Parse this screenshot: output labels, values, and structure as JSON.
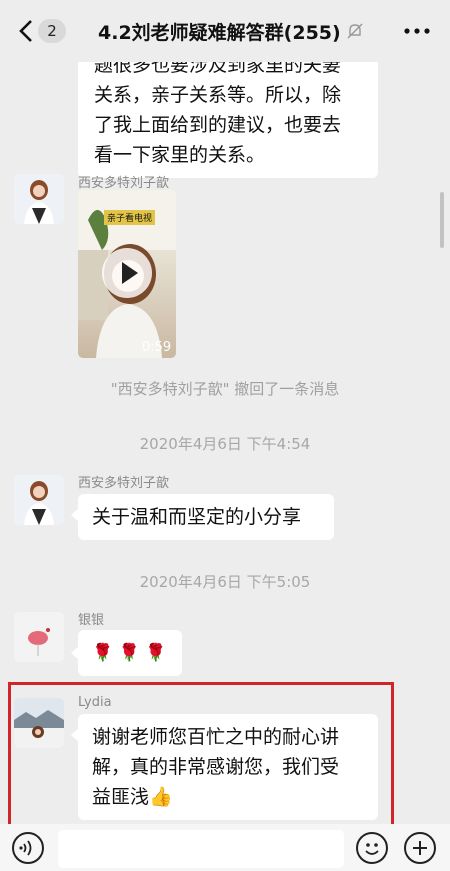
{
  "header": {
    "badge": "2",
    "title": "4.2刘老师疑难解答群(255)"
  },
  "messages": {
    "m1": {
      "lines": [
        "题很多也要涉及到家里的夫妻",
        "关系，亲子关系等。所以，除",
        "了我上面给到的建议，也要去",
        "看一下家里的关系。"
      ]
    },
    "m2": {
      "sender": "西安多特刘子歆",
      "video_caption": "亲子看电视",
      "duration": "0:59"
    },
    "sys1": "\"西安多特刘子歆\" 撤回了一条消息",
    "time1": "2020年4月6日 下午4:54",
    "m3": {
      "sender": "西安多特刘子歆",
      "text": "关于温和而坚定的小分享"
    },
    "time2": "2020年4月6日 下午5:05",
    "m4": {
      "sender": "银银",
      "text": "🌹 🌹 🌹"
    },
    "m5": {
      "sender": "Lydia",
      "lines": [
        "谢谢老师您百忙之中的耐心讲",
        "解，真的非常感谢您，我们受",
        "益匪浅👍"
      ]
    }
  },
  "icons": {
    "back": "chevron-left-icon",
    "mute": "mute-bell-icon",
    "more": "more-dots-icon",
    "voice": "voice-icon",
    "emoji": "emoji-icon",
    "plus": "plus-icon"
  },
  "colors": {
    "background": "#ededed",
    "bubble": "#ffffff",
    "highlight": "#d0262a"
  }
}
